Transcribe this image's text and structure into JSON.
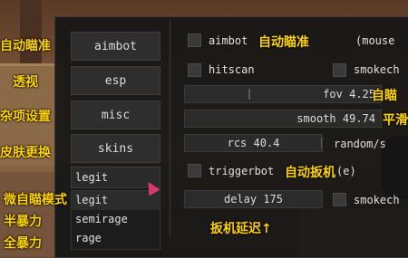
{
  "nav": {
    "aimbot": "aimbot",
    "esp": "esp",
    "misc": "misc",
    "skins": "skins"
  },
  "mode": {
    "selected": "legit",
    "options": [
      "legit",
      "semirage",
      "rage"
    ]
  },
  "aimbot_panel": {
    "aimbot_label": "aimbot",
    "mouse_key": "(mouse ",
    "hitscan_label": "hitscan",
    "smoke_check_1": "smokech",
    "fov": "fov 4.25",
    "smooth": "smooth 49.74",
    "rcs": "rcs 40.4",
    "random": "random/s",
    "triggerbot_label": "triggerbot",
    "trigger_key": "(e)",
    "delay": "delay 175",
    "smoke_check_2": "smokech"
  },
  "annotations": {
    "left": [
      "自动瞄准",
      "透视",
      "杂项设置",
      "皮肤更换",
      "微自瞄模式",
      "半暴力",
      "全暴力"
    ],
    "aimbot": "自动瞄准",
    "fov": "自瞄",
    "smooth": "平滑",
    "triggerbot": "自动扳机",
    "delay": "扳机延迟↑"
  },
  "colors": {
    "annotation": "#ffd400",
    "panel": "#161616",
    "cursor": "#d83a70"
  },
  "values": {
    "fov": 4.25,
    "smooth": 49.74,
    "rcs": 40.4,
    "delay": 175
  }
}
